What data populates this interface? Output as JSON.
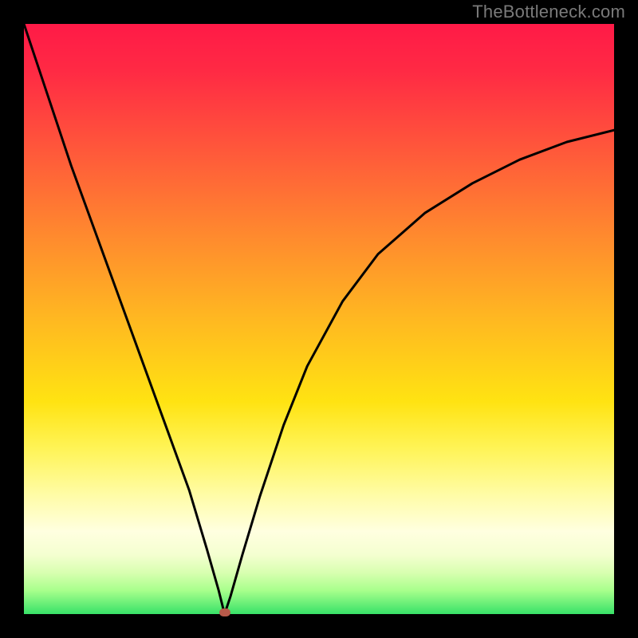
{
  "watermark": "TheBottleneck.com",
  "colors": {
    "frame": "#000000",
    "curve": "#000000",
    "marker": "#b75a4a",
    "gradient_top": "#ff1a47",
    "gradient_bottom": "#38e268"
  },
  "chart_data": {
    "type": "line",
    "title": "",
    "xlabel": "",
    "ylabel": "",
    "xlim": [
      0,
      100
    ],
    "ylim": [
      0,
      100
    ],
    "grid": false,
    "legend": false,
    "marker": {
      "x": 34,
      "y": 0
    },
    "series": [
      {
        "name": "curve",
        "x": [
          0,
          4,
          8,
          12,
          16,
          20,
          24,
          28,
          31,
          33,
          34,
          35,
          37,
          40,
          44,
          48,
          54,
          60,
          68,
          76,
          84,
          92,
          100
        ],
        "values": [
          100,
          88,
          76,
          65,
          54,
          43,
          32,
          21,
          11,
          4,
          0,
          3,
          10,
          20,
          32,
          42,
          53,
          61,
          68,
          73,
          77,
          80,
          82
        ]
      }
    ]
  }
}
